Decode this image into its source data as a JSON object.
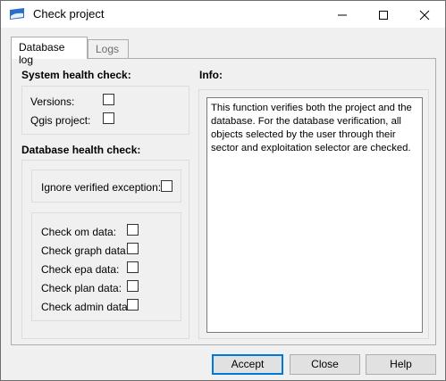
{
  "window": {
    "title": "Check project"
  },
  "tabs": [
    {
      "label": "Database log",
      "active": true
    },
    {
      "label": "Logs",
      "active": false
    }
  ],
  "system_health": {
    "title": "System health check:",
    "items": [
      {
        "label": "Versions:",
        "checked": false
      },
      {
        "label": "Qgis project:",
        "checked": false
      }
    ]
  },
  "database_health": {
    "title": "Database health check:",
    "ignore": {
      "label": "Ignore verified exception:",
      "checked": false
    },
    "items": [
      {
        "label": "Check om data:",
        "checked": false
      },
      {
        "label": "Check graph data:",
        "checked": false
      },
      {
        "label": "Check epa data:",
        "checked": false
      },
      {
        "label": "Check plan data:",
        "checked": false
      },
      {
        "label": "Check admin data:",
        "checked": false
      }
    ]
  },
  "info": {
    "title": "Info:",
    "text": "This function verifies both the project and the database. For the database verification, all objects selected by the user through their sector and exploitation selector are checked."
  },
  "buttons": {
    "accept": "Accept",
    "close": "Close",
    "help": "Help"
  }
}
